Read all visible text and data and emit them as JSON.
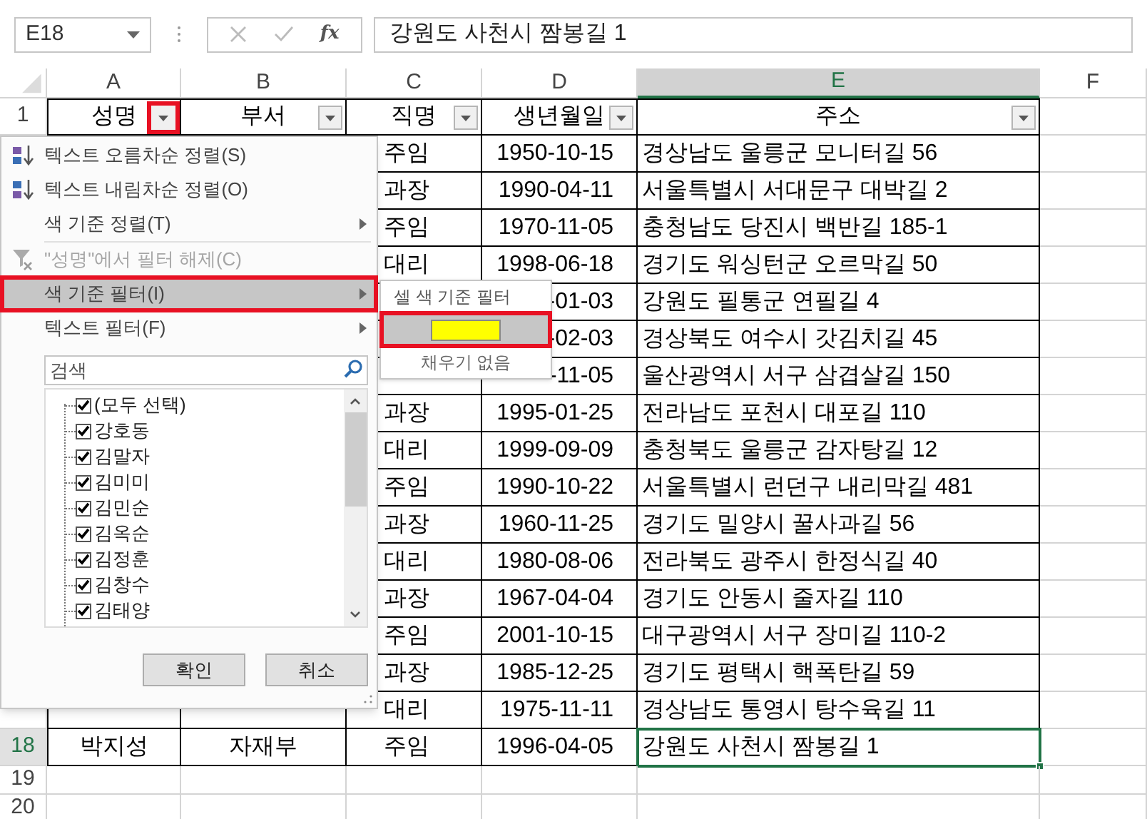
{
  "name_box": "E18",
  "function_label": "fx",
  "formula": "강원도 사천시 짬봉길 1",
  "columns": [
    {
      "label": "A",
      "selected": false
    },
    {
      "label": "B",
      "selected": false
    },
    {
      "label": "C",
      "selected": false
    },
    {
      "label": "D",
      "selected": false
    },
    {
      "label": "E",
      "selected": true
    },
    {
      "label": "F",
      "selected": false
    }
  ],
  "header_row": {
    "number": "1",
    "cells": [
      {
        "text": "성명",
        "annotated": true
      },
      {
        "text": "부서",
        "annotated": false
      },
      {
        "text": "직명",
        "annotated": false
      },
      {
        "text": "생년월일",
        "annotated": false
      },
      {
        "text": "주소",
        "annotated": false
      }
    ]
  },
  "rows": [
    {
      "C": "주임",
      "D": "1950-10-15",
      "E": "경상남도 울릉군 모니터길 56"
    },
    {
      "C": "과장",
      "D": "1990-04-11",
      "E": "서울특별시 서대문구 대박길 2"
    },
    {
      "C": "주임",
      "D": "1970-11-05",
      "E": "충청남도 당진시 백반길 185-1"
    },
    {
      "C": "대리",
      "D": "1998-06-18",
      "E": "경기도 워싱턴군 오르막길 50"
    },
    {
      "D": "-01-03",
      "E": "강원도 필통군 연필길 4"
    },
    {
      "D": "-02-03",
      "E": "경상북도 여수시 갓김치길 45"
    },
    {
      "D": "-11-05",
      "E": "울산광역시 서구 삼겹살길 150"
    },
    {
      "C": "과장",
      "D": "1995-01-25",
      "E": "전라남도 포천시 대포길 110"
    },
    {
      "C": "대리",
      "D": "1999-09-09",
      "E": "충청북도 울릉군 감자탕길 12"
    },
    {
      "C": "주임",
      "D": "1990-10-22",
      "E": "서울특별시 런던구 내리막길 481"
    },
    {
      "C": "과장",
      "D": "1960-11-25",
      "E": "경기도 밀양시 꿀사과길 56"
    },
    {
      "C": "대리",
      "D": "1980-08-06",
      "E": "전라북도 광주시 한정식길 40"
    },
    {
      "C": "과장",
      "D": "1967-04-04",
      "E": "경기도 안동시 줄자길 110"
    },
    {
      "C": "주임",
      "D": "2001-10-15",
      "E": "대구광역시 서구 장미길 110-2"
    },
    {
      "C": "과장",
      "D": "1985-12-25",
      "E": "경기도 평택시 핵폭탄길 59"
    },
    {
      "C": "대리",
      "D": "1975-11-11",
      "E": "경상남도 통영시 탕수육길 11"
    },
    {
      "number": "18",
      "selected": true,
      "A": "박지성",
      "B": "자재부",
      "C": "주임",
      "D": "1996-04-05",
      "E": "강원도 사천시 짬봉길 1"
    },
    {
      "number": "19",
      "selected": false
    },
    {
      "number": "20",
      "selected": false
    }
  ],
  "filter_menu": {
    "items": [
      {
        "kind": "sort_ascending",
        "label": "텍스트 오름차순 정렬(S)",
        "submenu": false,
        "disabled": false,
        "selected": false,
        "annotated": false
      },
      {
        "kind": "sort_descending",
        "label": "텍스트 내림차순 정렬(O)",
        "submenu": false,
        "disabled": false,
        "selected": false,
        "annotated": false
      },
      {
        "kind": "plain",
        "label": "색 기준 정렬(T)",
        "submenu": true,
        "disabled": false,
        "selected": false,
        "annotated": false
      },
      {
        "kind": "separator"
      },
      {
        "kind": "clear_filter",
        "label": "\"성명\"에서 필터 해제(C)",
        "submenu": false,
        "disabled": true,
        "selected": false,
        "annotated": false
      },
      {
        "kind": "plain",
        "label": "색 기준 필터(I)",
        "submenu": true,
        "disabled": false,
        "selected": true,
        "annotated": true
      },
      {
        "kind": "plain",
        "label": "텍스트 필터(F)",
        "submenu": true,
        "disabled": false,
        "selected": false,
        "annotated": false
      }
    ],
    "search": {
      "placeholder": "검색"
    },
    "values": [
      {
        "label": "(모두 선택)",
        "checked": true
      },
      {
        "label": "강호동",
        "checked": true
      },
      {
        "label": "김말자",
        "checked": true
      },
      {
        "label": "김미미",
        "checked": true
      },
      {
        "label": "김민순",
        "checked": true
      },
      {
        "label": "김옥순",
        "checked": true
      },
      {
        "label": "김정훈",
        "checked": true
      },
      {
        "label": "김창수",
        "checked": true
      },
      {
        "label": "김태양",
        "checked": true
      }
    ],
    "buttons": [
      "확인",
      "취소"
    ]
  },
  "color_submenu": {
    "title": "셀 색 기준 필터",
    "swatches": [
      {
        "color": "#ffff00",
        "selected": true,
        "annotated": true
      }
    ],
    "no_fill": "채우기 없음"
  }
}
